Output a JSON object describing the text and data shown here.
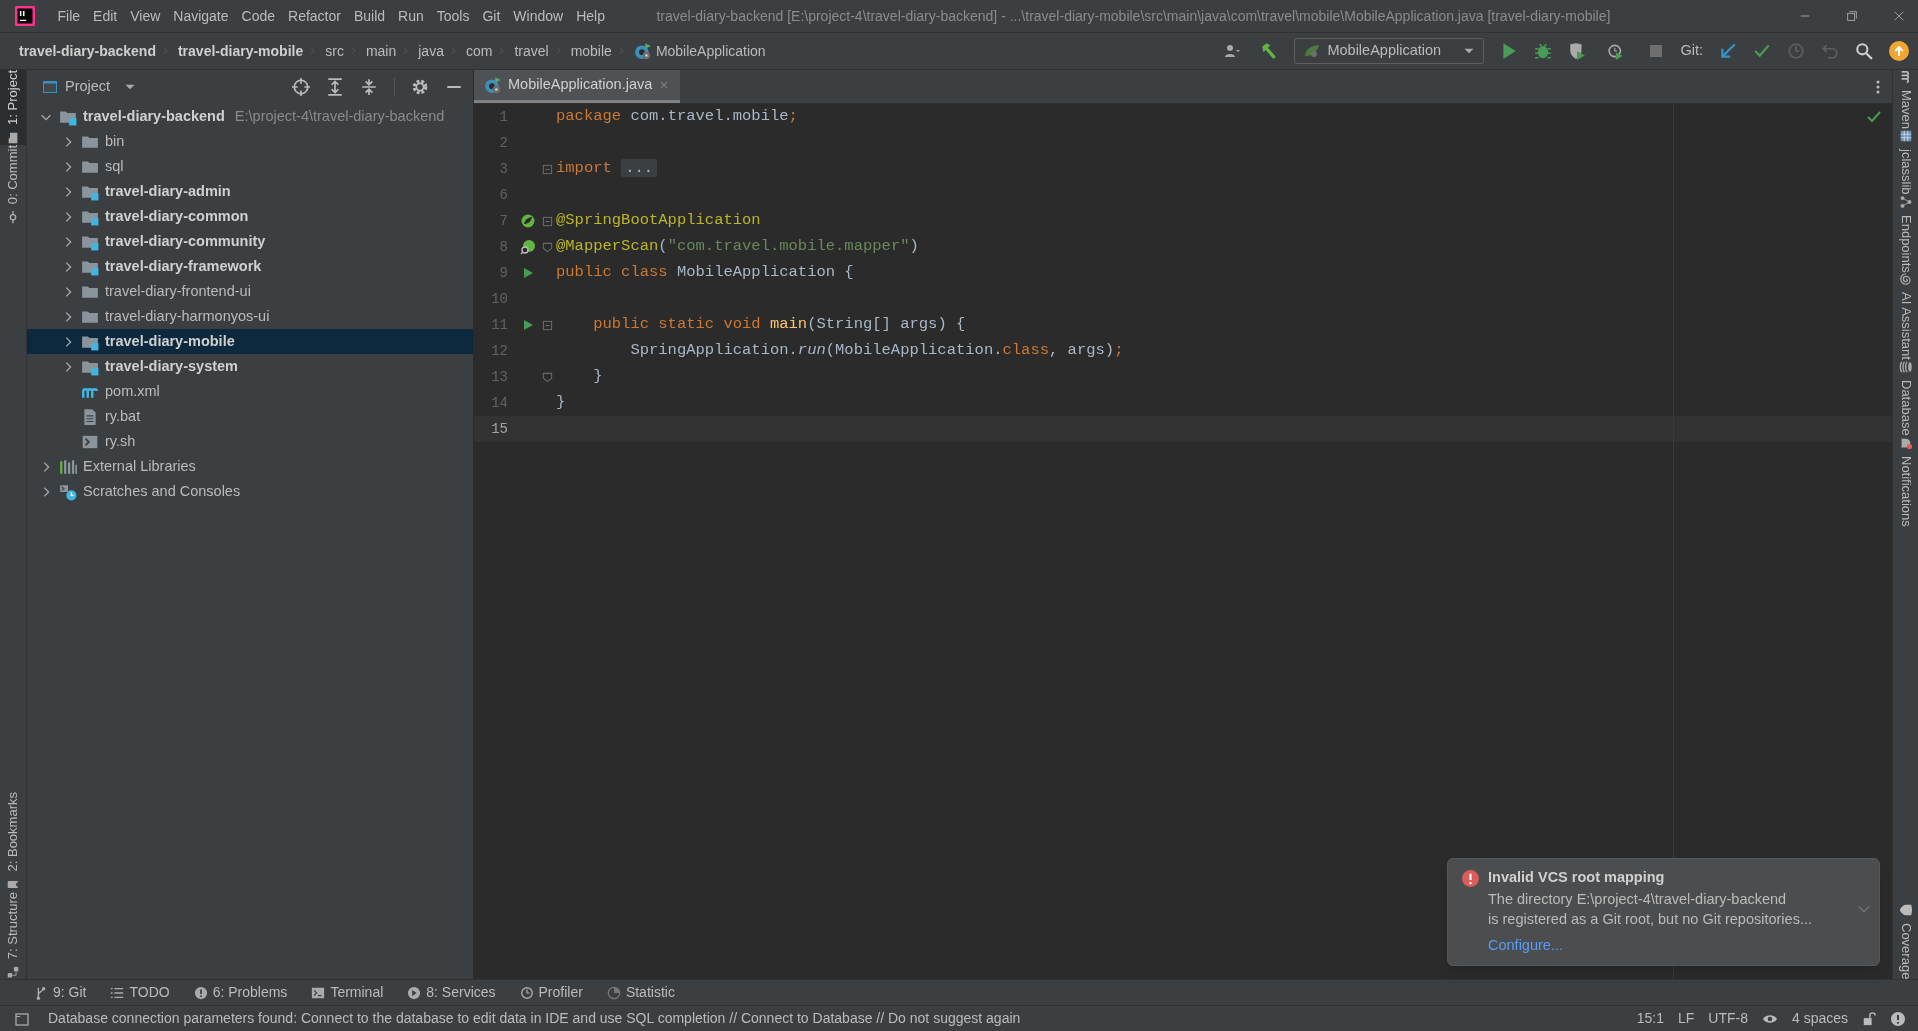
{
  "title_bar": {
    "menu": [
      "File",
      "Edit",
      "View",
      "Navigate",
      "Code",
      "Refactor",
      "Build",
      "Run",
      "Tools",
      "Git",
      "Window",
      "Help"
    ],
    "title": "travel-diary-backend [E:\\project-4\\travel-diary-backend] - ...\\travel-diary-mobile\\src\\main\\java\\com\\travel\\mobile\\MobileApplication.java [travel-diary-mobile]"
  },
  "navigation_bar": {
    "breadcrumbs": [
      {
        "label": "travel-diary-backend",
        "bold": true
      },
      {
        "label": "travel-diary-mobile",
        "bold": true
      },
      {
        "label": "src",
        "bold": false
      },
      {
        "label": "main",
        "bold": false
      },
      {
        "label": "java",
        "bold": false
      },
      {
        "label": "com",
        "bold": false
      },
      {
        "label": "travel",
        "bold": false
      },
      {
        "label": "mobile",
        "bold": false
      },
      {
        "label": "MobileApplication",
        "bold": false,
        "kind": "class"
      }
    ],
    "run_configuration": "MobileApplication",
    "git_label": "Git:"
  },
  "left_tool_strip": {
    "top": [
      {
        "label": "1: Project",
        "selected": true,
        "kind": "folder"
      },
      {
        "label": "0: Commit",
        "selected": false,
        "kind": "commit"
      }
    ],
    "bottom": [
      {
        "label": "2: Bookmarks",
        "selected": false,
        "kind": "bookmark"
      },
      {
        "label": "7: Structure",
        "selected": false,
        "kind": "structure"
      }
    ]
  },
  "project_panel": {
    "title": "Project",
    "tree": [
      {
        "label": "travel-diary-backend",
        "hint": "E:\\project-4\\travel-diary-backend",
        "kind": "module",
        "bold": true,
        "expanded": true,
        "selected": false,
        "children": [
          {
            "label": "bin",
            "kind": "folder",
            "bold": false,
            "expanded": false,
            "selected": false
          },
          {
            "label": "sql",
            "kind": "folder",
            "bold": false,
            "expanded": false,
            "selected": false
          },
          {
            "label": "travel-diary-admin",
            "kind": "module",
            "bold": true,
            "expanded": false,
            "selected": false
          },
          {
            "label": "travel-diary-common",
            "kind": "module",
            "bold": true,
            "expanded": false,
            "selected": false
          },
          {
            "label": "travel-diary-community",
            "kind": "module",
            "bold": true,
            "expanded": false,
            "selected": false
          },
          {
            "label": "travel-diary-framework",
            "kind": "module",
            "bold": true,
            "expanded": false,
            "selected": false
          },
          {
            "label": "travel-diary-frontend-ui",
            "kind": "folder",
            "bold": false,
            "expanded": false,
            "selected": false
          },
          {
            "label": "travel-diary-harmonyos-ui",
            "kind": "folder",
            "bold": false,
            "expanded": false,
            "selected": false
          },
          {
            "label": "travel-diary-mobile",
            "kind": "module",
            "bold": true,
            "expanded": false,
            "selected": true
          },
          {
            "label": "travel-diary-system",
            "kind": "module",
            "bold": true,
            "expanded": false,
            "selected": false
          },
          {
            "label": "pom.xml",
            "kind": "maven",
            "bold": false,
            "selected": false
          },
          {
            "label": "ry.bat",
            "kind": "text-file",
            "bold": false,
            "selected": false
          },
          {
            "label": "ry.sh",
            "kind": "shell-file",
            "bold": false,
            "selected": false
          }
        ]
      },
      {
        "label": "External Libraries",
        "kind": "libraries",
        "bold": false,
        "expanded": false,
        "selected": false
      },
      {
        "label": "Scratches and Consoles",
        "kind": "scratches",
        "bold": false,
        "expanded": false,
        "selected": false
      }
    ]
  },
  "editor": {
    "tabs": [
      {
        "label": "MobileApplication.java",
        "selected": true
      }
    ],
    "lines": [
      {
        "number": "1",
        "tokens": [
          {
            "text": "package ",
            "kind": "keyword"
          },
          {
            "text": "com.travel.mobile",
            "kind": "plain"
          },
          {
            "text": ";",
            "kind": "keyword"
          }
        ]
      },
      {
        "number": "2"
      },
      {
        "number": "3",
        "fold_start": true,
        "tokens": [
          {
            "text": "import ",
            "kind": "keyword"
          },
          {
            "text": "...",
            "kind": "folded"
          }
        ]
      },
      {
        "number": "6"
      },
      {
        "number": "7",
        "bean": true,
        "fold_start": true,
        "tokens": [
          {
            "text": "@SpringBootApplication",
            "kind": "annotation"
          }
        ]
      },
      {
        "number": "8",
        "bean_search": true,
        "fold_end": true,
        "tokens": [
          {
            "text": "@MapperScan",
            "kind": "annotation"
          },
          {
            "text": "(",
            "kind": "plain"
          },
          {
            "text": "\"com.travel.mobile.mapper\"",
            "kind": "string"
          },
          {
            "text": ")",
            "kind": "plain"
          }
        ]
      },
      {
        "number": "9",
        "runnable": true,
        "tokens": [
          {
            "text": "public class ",
            "kind": "keyword"
          },
          {
            "text": "MobileApplication {",
            "kind": "plain"
          }
        ]
      },
      {
        "number": "10"
      },
      {
        "number": "11",
        "runnable": true,
        "fold_start": true,
        "tokens": [
          {
            "text": "    public static void ",
            "kind": "keyword"
          },
          {
            "text": "main",
            "kind": "method"
          },
          {
            "text": "(String[] args) {",
            "kind": "plain"
          }
        ]
      },
      {
        "number": "12",
        "tokens": [
          {
            "text": "        SpringApplication.",
            "kind": "plain"
          },
          {
            "text": "run",
            "kind": "static-call"
          },
          {
            "text": "(MobileApplication.",
            "kind": "plain"
          },
          {
            "text": "class",
            "kind": "keyword"
          },
          {
            "text": ", args)",
            "kind": "plain"
          },
          {
            "text": ";",
            "kind": "keyword"
          }
        ]
      },
      {
        "number": "13",
        "fold_end": true,
        "tokens": [
          {
            "text": "    }",
            "kind": "plain"
          }
        ]
      },
      {
        "number": "14",
        "tokens": [
          {
            "text": "}",
            "kind": "plain"
          }
        ]
      },
      {
        "number": "15",
        "current": true
      }
    ]
  },
  "right_tool_strip": {
    "top": [
      {
        "label": "Maven",
        "kind": "maven"
      },
      {
        "label": "jclasslib",
        "kind": "grid"
      },
      {
        "label": "Endpoints",
        "kind": "endpoints"
      },
      {
        "label": "AI Assistant",
        "kind": "spiral"
      },
      {
        "label": "Database",
        "kind": "database"
      },
      {
        "label": "Notifications",
        "kind": "bell"
      }
    ],
    "bottom": [
      {
        "label": "Coverage",
        "kind": "shield"
      }
    ]
  },
  "notification": {
    "title": "Invalid VCS root mapping",
    "body_lines": [
      "The directory E:\\project-4\\travel-diary-backend",
      "is registered as a Git root, but no Git repositories..."
    ],
    "link": "Configure..."
  },
  "tool_window_bar": [
    {
      "label": "9: Git",
      "kind": "git"
    },
    {
      "label": "TODO",
      "kind": "list"
    },
    {
      "label": "6: Problems",
      "kind": "problems"
    },
    {
      "label": "Terminal",
      "kind": "terminal"
    },
    {
      "label": "8: Services",
      "kind": "services"
    },
    {
      "label": "Profiler",
      "kind": "profiler"
    },
    {
      "label": "Statistic",
      "kind": "statistic"
    }
  ],
  "status_bar": {
    "message": "Database connection parameters found: Connect to the database to edit data in IDE and use SQL completion // Connect to Database // Do not suggest again",
    "items": [
      "15:1",
      "LF",
      "UTF-8",
      "4 spaces"
    ]
  }
}
